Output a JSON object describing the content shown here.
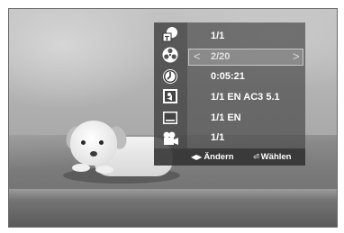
{
  "info_menu": {
    "rows": [
      {
        "icon": "title-icon",
        "value": "1/1"
      },
      {
        "icon": "chapter-icon",
        "value": "2/20",
        "selected": true
      },
      {
        "icon": "time-icon",
        "value": "0:05:21"
      },
      {
        "icon": "audio-icon",
        "value": "1/1 EN AC3 5.1"
      },
      {
        "icon": "subtitle-icon",
        "value": "1/1 EN"
      },
      {
        "icon": "camera-angle-icon",
        "value": "1/1"
      }
    ],
    "selector": {
      "left_arrow": "<",
      "right_arrow": ">"
    },
    "footer": {
      "change_glyph": "◀▶",
      "change_label": "Ändern",
      "select_glyph": "⏎",
      "select_label": "Wählen"
    }
  }
}
